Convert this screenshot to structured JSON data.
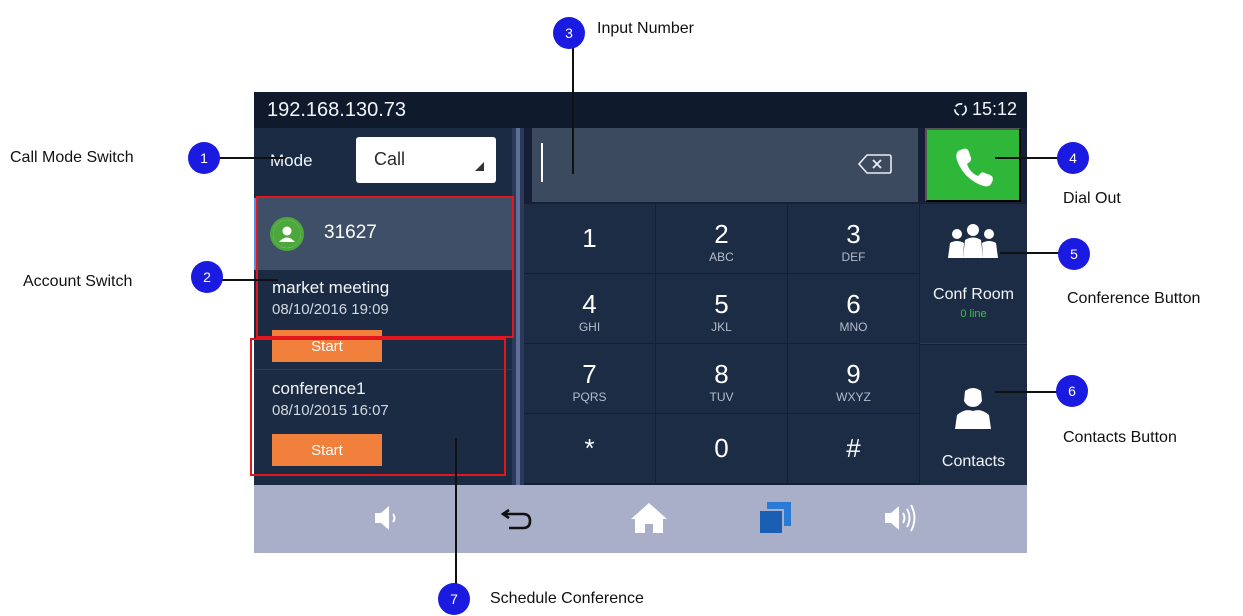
{
  "status_bar": {
    "ip": "192.168.130.73",
    "time": "15:12"
  },
  "mode": {
    "label": "Mode",
    "value": "Call"
  },
  "account": {
    "number": "31627"
  },
  "conferences": [
    {
      "name": "market meeting",
      "time": "08/10/2016 19:09",
      "button": "Start"
    },
    {
      "name": "conference1",
      "time": "08/10/2015 16:07",
      "button": "Start"
    }
  ],
  "keypad": [
    {
      "digit": "1",
      "letters": ""
    },
    {
      "digit": "2",
      "letters": "ABC"
    },
    {
      "digit": "3",
      "letters": "DEF"
    },
    {
      "digit": "4",
      "letters": "GHI"
    },
    {
      "digit": "5",
      "letters": "JKL"
    },
    {
      "digit": "6",
      "letters": "MNO"
    },
    {
      "digit": "7",
      "letters": "PQRS"
    },
    {
      "digit": "8",
      "letters": "TUV"
    },
    {
      "digit": "9",
      "letters": "WXYZ"
    },
    {
      "digit": "*",
      "letters": ""
    },
    {
      "digit": "0",
      "letters": ""
    },
    {
      "digit": "#",
      "letters": ""
    }
  ],
  "side": {
    "conf_room": "Conf Room",
    "conf_lines": "0 line",
    "contacts": "Contacts"
  },
  "nav_icons": [
    "volume-down-icon",
    "back-icon",
    "home-icon",
    "multitask-icon",
    "volume-up-icon"
  ],
  "annotations": {
    "n1": "1",
    "n2": "2",
    "n3": "3",
    "n4": "4",
    "n5": "5",
    "n6": "6",
    "n7": "7",
    "call_mode_switch": "Call Mode Switch",
    "account_switch": "Account Switch",
    "input_number": "Input Number",
    "dial_out": "Dial Out",
    "conference_button": "Conference Button",
    "contacts_button": "Contacts Button",
    "schedule_conference": "Schedule Conference"
  },
  "colors": {
    "screen_bg": "#152036",
    "dial_green": "#2fb73a",
    "start_orange": "#f0803c",
    "callout_blue": "#1a1ae0",
    "highlight_red": "#e3161e",
    "line_count_green": "#39c24a"
  }
}
